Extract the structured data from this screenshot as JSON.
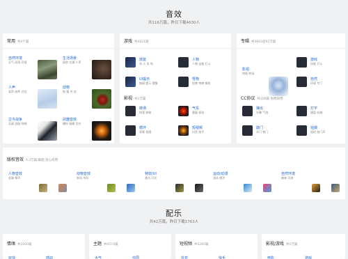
{
  "sfx": {
    "title": "音效",
    "subtitle": "共116万篇，昨日下载4630人",
    "common": {
      "title": "常用",
      "count": "共4个篇",
      "items": [
        {
          "title": "自然环境",
          "tags": "天气 风雨 环境"
        },
        {
          "title": "生活场景",
          "tags": "厨房 交通 人声"
        },
        {
          "title": "人声",
          "tags": "笑声 欢呼 对白"
        },
        {
          "title": "动物",
          "tags": "狗 猫 鸟 虫"
        },
        {
          "title": "古今战争",
          "tags": "兵器 战鼓 吶喊"
        },
        {
          "title": "武器音效",
          "tags": "爆炸 碰撞 剑刃"
        }
      ]
    },
    "game": {
      "title": "游戏",
      "count": "共4021篇",
      "items": [
        {
          "title": "技能",
          "tags": "冰 火 风 电"
        },
        {
          "title": "人物",
          "tags": "人物 走路 打斗"
        },
        {
          "title": "UI提示",
          "tags": "按键 提示 提醒"
        },
        {
          "title": "怪物",
          "tags": "怪兽 咆哮 嘶吼"
        }
      ]
    },
    "film": {
      "title": "影视",
      "count": "共1万篇",
      "items": [
        {
          "title": "转场",
          "tags": "快速 穿梭"
        },
        {
          "title": "气氛",
          "tags": "悬疑 紧张"
        },
        {
          "title": "循环",
          "tags": "背景 氛围"
        },
        {
          "title": "短视频",
          "tags": "抖音 快手"
        }
      ]
    },
    "pro": {
      "title": "专辑",
      "count": "共3603首92万篇",
      "film_label": "影视",
      "film_tags": "特效 转场",
      "items": [
        {
          "title": "游戏",
          "tags": "技能 打斗"
        },
        {
          "title": "自然",
          "tags": "环境 专门"
        }
      ]
    },
    "cc": {
      "title": "CC协议",
      "count": "共100篇 免费商用",
      "items": [
        {
          "title": "弹出",
          "tags": "光晕 气泡"
        },
        {
          "title": "打字",
          "tags": "键盘 机械"
        },
        {
          "title": "敲门",
          "tags": "木门 铁门"
        },
        {
          "title": "拍摄",
          "tags": "相机 快门声"
        }
      ]
    },
    "royalty": {
      "title": "版权音效",
      "count": "4.3万篇/最超 放心商用",
      "items": [
        {
          "title": "人物音效",
          "tags": "走路 拳声"
        },
        {
          "title": "动物音效",
          "tags": "狗叫 鸟叫"
        },
        {
          "title": "特效/UI",
          "tags": "激光 闪光"
        },
        {
          "title": "运动/动漫",
          "tags": "游泳 跑步"
        },
        {
          "title": "自然环境",
          "tags": "森林 河流"
        }
      ]
    }
  },
  "music": {
    "title": "配乐",
    "subtitle": "共42万篇，昨日下载1763人",
    "cards": [
      {
        "title": "情绪",
        "count": "共2000篇",
        "sub1": "欢快",
        "sub2": "感动"
      },
      {
        "title": "主题",
        "count": "共4574篇",
        "sub1": "大气",
        "sub2": "中国"
      },
      {
        "title": "短视频",
        "count": "共5285篇",
        "sub1": "抖音",
        "sub2": "快手"
      },
      {
        "title": "影视/游戏",
        "count": "共1万篇",
        "sub1": "电影",
        "sub2": "游戏"
      }
    ]
  },
  "colors": {
    "link": "#1e66c8",
    "background": "#f0f1f3"
  }
}
